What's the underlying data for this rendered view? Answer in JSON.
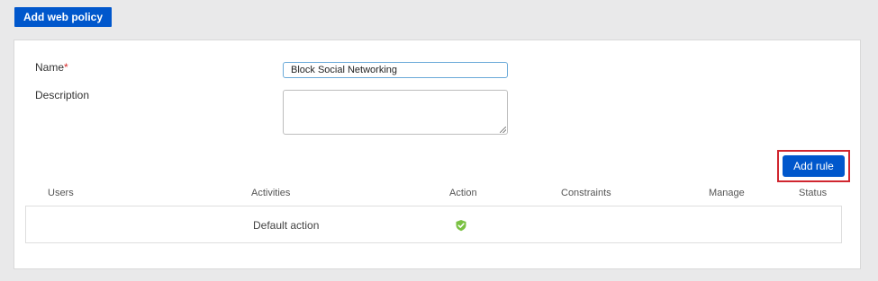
{
  "toolbar": {
    "add_web_policy_label": "Add web policy"
  },
  "form": {
    "name_label": "Name",
    "required_mark": "*",
    "name_value": "Block Social Networking",
    "description_label": "Description",
    "description_value": ""
  },
  "actions": {
    "add_rule_label": "Add rule"
  },
  "table": {
    "headers": [
      "Users",
      "Activities",
      "Action",
      "Constraints",
      "Manage",
      "Status"
    ],
    "rows": [
      {
        "users": "",
        "activities": "Default action",
        "action_icon": "shield-check-icon",
        "constraints": "",
        "manage": "",
        "status": ""
      }
    ]
  },
  "colors": {
    "primary": "#0057cc",
    "highlight": "#d0262f",
    "action_allow": "#7ac142"
  }
}
